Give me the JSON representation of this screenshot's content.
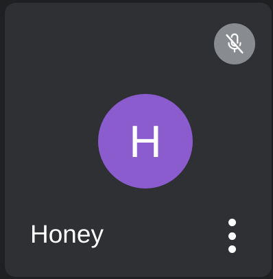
{
  "participant": {
    "initial": "H",
    "name": "Honey",
    "muted": true,
    "avatar_color": "#8a5ccd"
  },
  "icons": {
    "mic_status": "mic-off-icon",
    "menu": "more-vertical-icon"
  }
}
